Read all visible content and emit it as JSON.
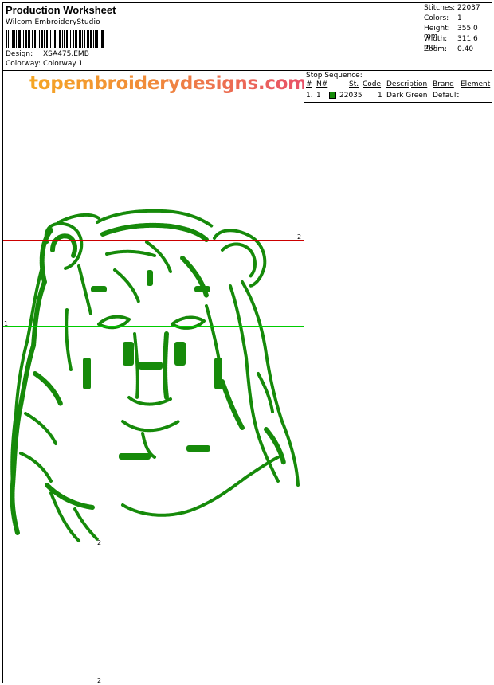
{
  "header": {
    "title": "Production Worksheet",
    "software": "Wilcom EmbroideryStudio",
    "design_label": "Design:",
    "design_value": "XSA475.EMB",
    "colorway_label": "Colorway:",
    "colorway_value": "Colorway 1"
  },
  "stats": {
    "stitches_label": "Stitches:",
    "stitches_value": "22037",
    "colors_label": "Colors:",
    "colors_value": "1",
    "height_label": "Height:",
    "height_value": "355.0 mm",
    "width_label": "Width:",
    "width_value": "311.6 mm",
    "zoom_label": "Zoom:",
    "zoom_value": "0.40"
  },
  "watermark": "topembroiderydesigns.com",
  "guides": {
    "v1_label": "1",
    "v2_top_label": "2",
    "v2_bottom_label": "2",
    "h1_label": "1",
    "h2_label": "2",
    "green": "#00cc00",
    "red": "#cc0000"
  },
  "design_color": "#168a0a",
  "stop_sequence": {
    "title": "Stop Sequence:",
    "columns": [
      "#",
      "N#",
      "St.",
      "Code",
      "Description",
      "Brand",
      "Element"
    ],
    "rows": [
      {
        "num": "1.",
        "n": "1",
        "color": "#168a0a",
        "st": "22035",
        "code": "1",
        "description": "Dark Green",
        "brand": "Default",
        "element": ""
      }
    ]
  }
}
